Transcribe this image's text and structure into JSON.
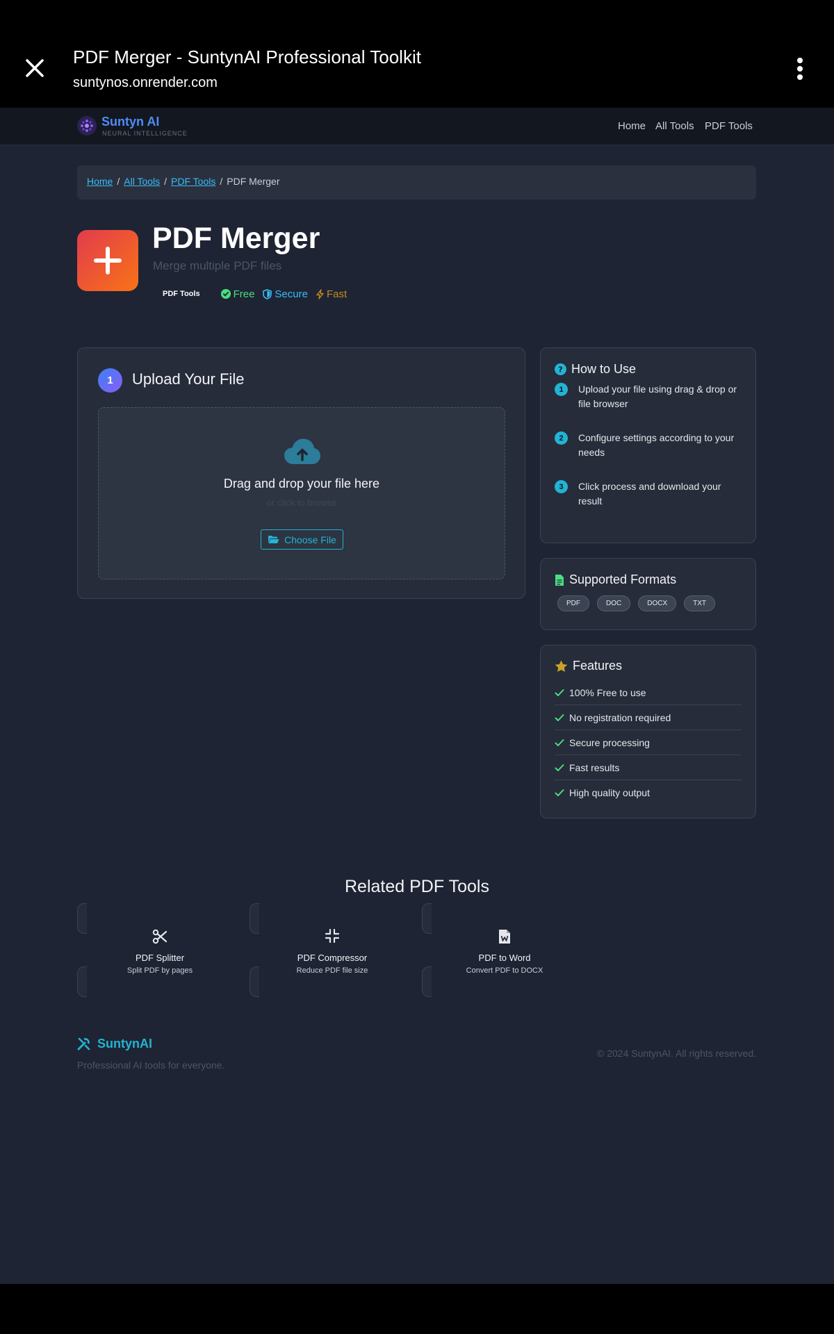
{
  "browser": {
    "title": "PDF Merger - SuntynAI Professional Toolkit",
    "url": "suntynos.onrender.com"
  },
  "nav": {
    "logo_name": "Suntyn AI",
    "logo_tagline": "NEURAL INTELLIGENCE",
    "links": [
      "Home",
      "All Tools",
      "PDF Tools"
    ]
  },
  "breadcrumb": {
    "items": [
      "Home",
      "All Tools",
      "PDF Tools"
    ],
    "separator": "/",
    "current": "PDF Merger"
  },
  "hero": {
    "icon": "plus-icon",
    "title": "PDF Merger",
    "subtitle": "Merge multiple PDF files",
    "category": "PDF Tools",
    "tags": {
      "free": "Free",
      "secure": "Secure",
      "fast": "Fast"
    }
  },
  "upload": {
    "step": "1",
    "title": "Upload Your File",
    "drop_title": "Drag and drop your file here",
    "drop_sub": "or click to browse",
    "button": "Choose File"
  },
  "howto": {
    "title": "How to Use",
    "steps": [
      {
        "num": "1",
        "text": "Upload your file using drag & drop or file browser"
      },
      {
        "num": "2",
        "text": "Configure settings according to your needs"
      },
      {
        "num": "3",
        "text": "Click process and download your result"
      }
    ]
  },
  "formats": {
    "title": "Supported Formats",
    "items": [
      "PDF",
      "DOC",
      "DOCX",
      "TXT"
    ]
  },
  "features": {
    "title": "Features",
    "items": [
      "100% Free to use",
      "No registration required",
      "Secure processing",
      "Fast results",
      "High quality output"
    ]
  },
  "related": {
    "title": "Related PDF Tools",
    "items": [
      {
        "name": "PDF Splitter",
        "desc": "Split PDF by pages",
        "icon": "scissors-icon"
      },
      {
        "name": "PDF Compressor",
        "desc": "Reduce PDF file size",
        "icon": "compress-icon"
      },
      {
        "name": "PDF to Word",
        "desc": "Convert PDF to DOCX",
        "icon": "word-file-icon"
      }
    ]
  },
  "footer": {
    "brand": "SuntynAI",
    "tagline": "Professional AI tools for everyone.",
    "copyright": "© 2024 SuntynAI. All rights reserved."
  },
  "colors": {
    "accent": "#22b4d4",
    "brand_blue": "#4f8cf7",
    "free_green": "#4ade80",
    "fast_amber": "#c98a1c",
    "hero_gradient_start": "#e23b4e",
    "hero_gradient_end": "#f97316"
  }
}
